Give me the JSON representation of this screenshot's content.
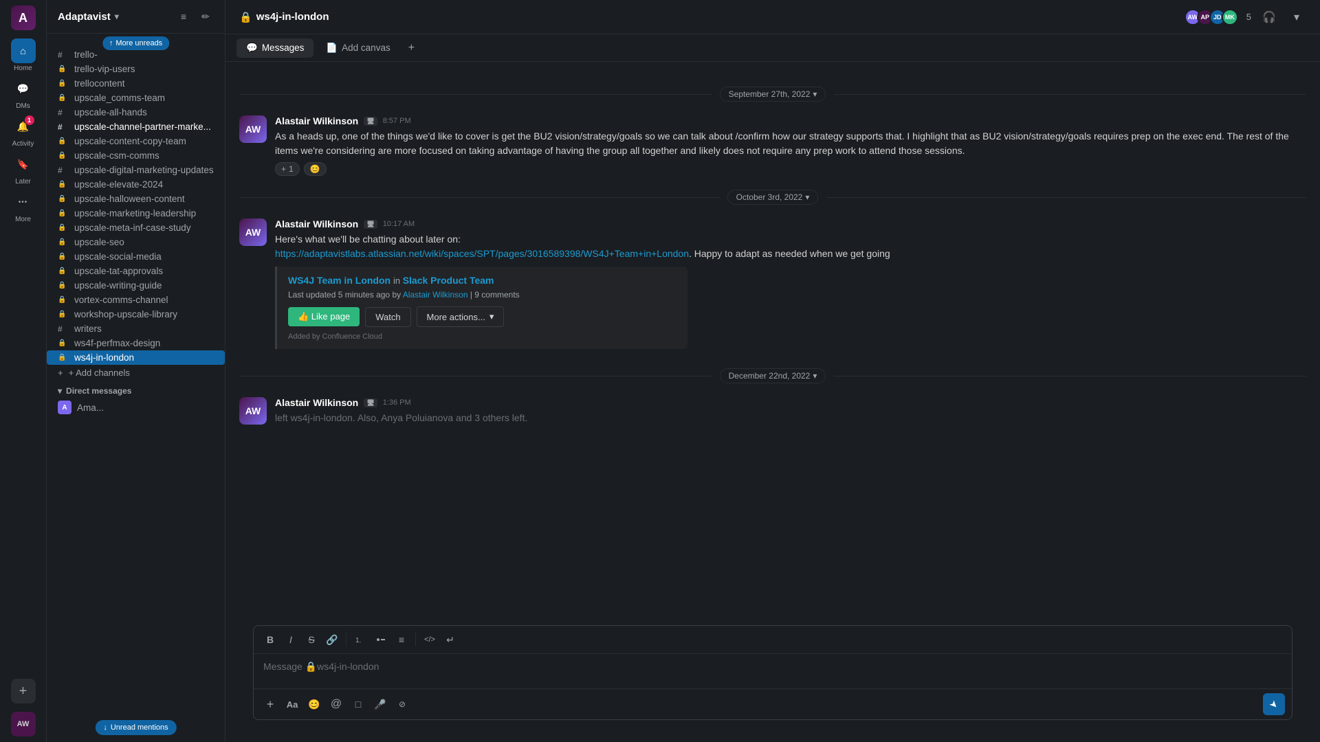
{
  "app": {
    "name": "Adaptavist",
    "workspace_icon_text": "A",
    "channel_name": "ws4j-in-london",
    "channel_lock": "🔒"
  },
  "iconbar": {
    "home_label": "Home",
    "dm_label": "DMs",
    "activity_label": "Activity",
    "later_label": "Later",
    "more_label": "More",
    "notifications_badge": "1"
  },
  "sidebar": {
    "title": "Adaptavist",
    "more_unreads": "More unreads",
    "channels": [
      {
        "type": "hash",
        "name": "trello-",
        "bold": false
      },
      {
        "type": "lock",
        "name": "trello-vip-users",
        "bold": false
      },
      {
        "type": "lock",
        "name": "trellocontent",
        "bold": false
      },
      {
        "type": "lock",
        "name": "upscale_comms-team",
        "bold": false
      },
      {
        "type": "hash",
        "name": "upscale-all-hands",
        "bold": false
      },
      {
        "type": "hash",
        "name": "upscale-channel-partner-marke...",
        "bold": true
      },
      {
        "type": "lock",
        "name": "upscale-content-copy-team",
        "bold": false
      },
      {
        "type": "lock",
        "name": "upscale-csm-comms",
        "bold": false
      },
      {
        "type": "hash",
        "name": "upscale-digital-marketing-updates",
        "bold": false
      },
      {
        "type": "lock",
        "name": "upscale-elevate-2024",
        "bold": false
      },
      {
        "type": "lock",
        "name": "upscale-halloween-content",
        "bold": false
      },
      {
        "type": "lock",
        "name": "upscale-marketing-leadership",
        "bold": false
      },
      {
        "type": "lock",
        "name": "upscale-meta-inf-case-study",
        "bold": false
      },
      {
        "type": "lock",
        "name": "upscale-seo",
        "bold": false
      },
      {
        "type": "lock",
        "name": "upscale-social-media",
        "bold": false
      },
      {
        "type": "lock",
        "name": "upscale-tat-approvals",
        "bold": false
      },
      {
        "type": "lock",
        "name": "upscale-writing-guide",
        "bold": false
      },
      {
        "type": "lock",
        "name": "vortex-comms-channel",
        "bold": false
      },
      {
        "type": "lock",
        "name": "workshop-upscale-library",
        "bold": false
      },
      {
        "type": "hash",
        "name": "writers",
        "bold": false
      },
      {
        "type": "lock",
        "name": "ws4f-perfmax-design",
        "bold": false
      },
      {
        "type": "lock",
        "name": "ws4j-in-london",
        "bold": false,
        "active": true
      }
    ],
    "add_channels": "+ Add channels",
    "direct_messages_label": "Direct messages",
    "dm_items": [
      {
        "name": "Ama...",
        "initials": "A",
        "color": "#7b68ee"
      }
    ],
    "unread_mentions": "Unread mentions"
  },
  "channel": {
    "name": "ws4j-in-london",
    "lock": "🔒",
    "member_count": "5",
    "tabs": [
      {
        "label": "Messages",
        "active": true,
        "icon": "💬"
      },
      {
        "label": "Add canvas",
        "active": false,
        "icon": "📄"
      }
    ],
    "tab_add": "+"
  },
  "messages": [
    {
      "id": "msg1",
      "author": "Alastair Wilkinson",
      "badge": "AW",
      "time": "8:57 PM",
      "text": "As a heads up, one of the things we'd like to cover is get the BU2 vision/strategy/goals so we can talk about /confirm how our strategy supports that.  I highlight that as BU2 vision/strategy/goals requires prep on the exec end.  The rest of the items we're considering are more focused on taking advantage of having the group all together and likely does not require any prep work to attend those sessions.",
      "reactions": [
        {
          "emoji": "+",
          "count": "1"
        },
        {
          "emoji": "😊",
          "count": ""
        }
      ],
      "date_before": "September 27th, 2022"
    },
    {
      "id": "msg2",
      "author": "Alastair Wilkinson",
      "badge": "AW",
      "time": "10:17 AM",
      "text_before": "Here's what we'll be chatting about later on:",
      "link_url": "https://adaptavistlabs.atlassian.net/wiki/spaces/SPT/pages/3016589398/WS4J+Team+in+London",
      "link_text": "https://adaptavistlabs.atlassian.net/wiki/spaces/SPT/pages/3016589398/WS4J+Team+in+London",
      "text_after": ".  Happy to adapt as needed when we get going",
      "confluence": {
        "title": "WS4J Team in London",
        "space": "Slack Product Team",
        "meta": "Last updated 5 minutes ago by",
        "author": "Alastair Wilkinson",
        "comments": "9 comments",
        "btn_like": "👍 Like page",
        "btn_watch": "Watch",
        "btn_more": "More actions...",
        "footer": "Added by Confluence Cloud"
      },
      "date_before": "October 3rd, 2022"
    },
    {
      "id": "msg3",
      "author": "Alastair Wilkinson",
      "badge": "AW",
      "time": "1:36 PM",
      "system_text": "left ws4j-in-london. Also, Anya Poluianova and 3 others left.",
      "date_before": "December 22nd, 2022"
    }
  ],
  "composer": {
    "placeholder": "Message 🔒ws4j-in-london",
    "toolbar": {
      "bold": "B",
      "italic": "I",
      "strikethrough": "S",
      "link": "🔗",
      "ordered_list": "ol",
      "unordered_list": "ul",
      "indent": "≡",
      "code": "</>",
      "quote": "↵"
    },
    "bottom_icons": [
      "+",
      "Aa",
      "😊",
      "@",
      "□",
      "🎤",
      "⊘"
    ]
  }
}
